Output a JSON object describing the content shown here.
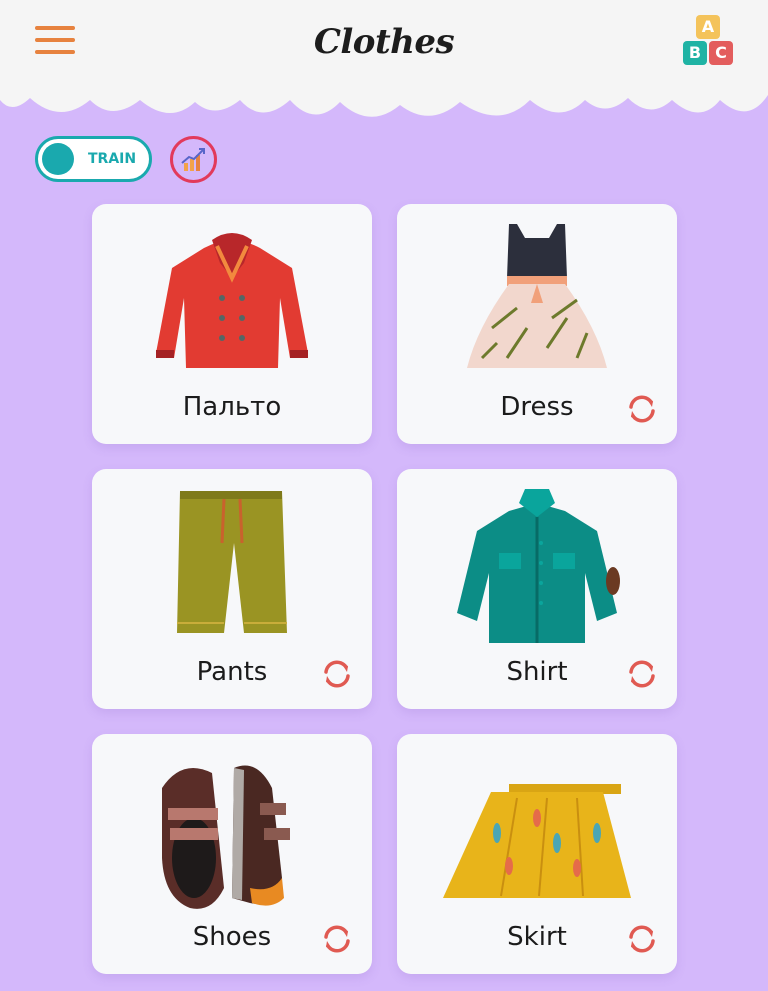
{
  "header": {
    "title": "Clothes",
    "menu_icon": "hamburger-menu-icon",
    "abc_icon": "abc-blocks-icon",
    "abc_letters": [
      "A",
      "B",
      "C"
    ]
  },
  "controls": {
    "train_label": "TRAIN",
    "stats_icon": "chart-growth-icon"
  },
  "colors": {
    "background": "#d4b8fb",
    "header": "#f5f5f5",
    "accent_orange": "#e7823f",
    "teal": "#1aa9ae",
    "red": "#e23a5b"
  },
  "cards": [
    {
      "label": "Пальто",
      "image": "coat",
      "has_reload": false
    },
    {
      "label": "Dress",
      "image": "dress",
      "has_reload": true
    },
    {
      "label": "Pants",
      "image": "pants",
      "has_reload": true
    },
    {
      "label": "Shirt",
      "image": "shirt",
      "has_reload": true
    },
    {
      "label": "Shoes",
      "image": "shoes",
      "has_reload": true
    },
    {
      "label": "Skirt",
      "image": "skirt",
      "has_reload": true
    }
  ]
}
